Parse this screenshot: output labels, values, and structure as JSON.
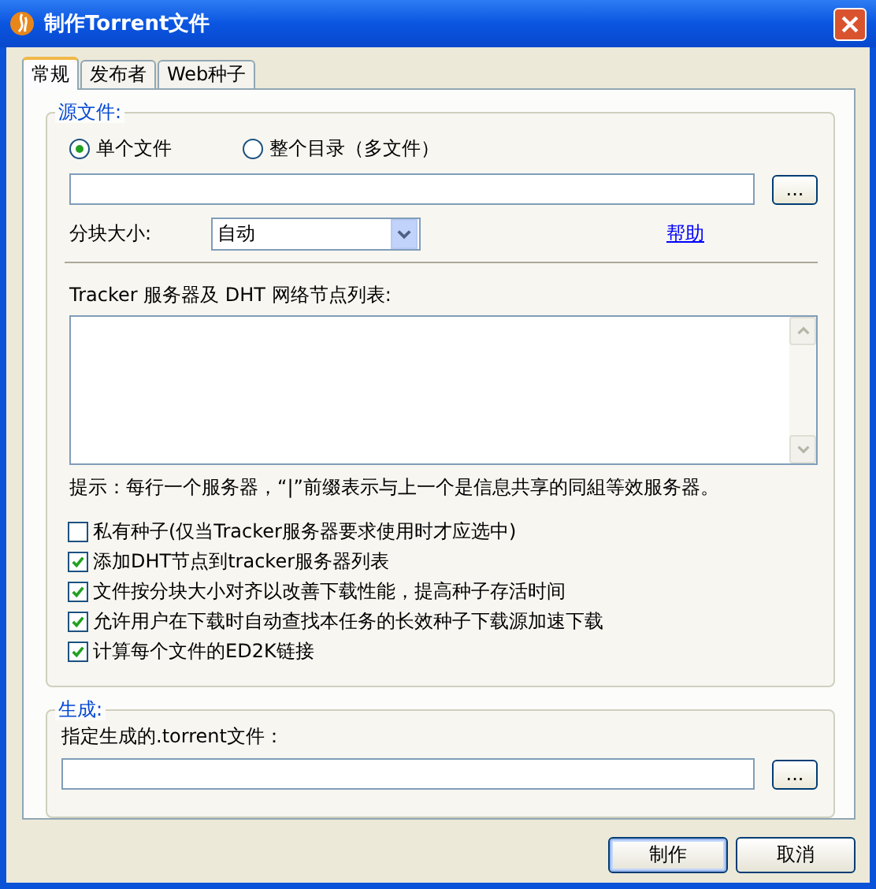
{
  "window": {
    "title": "制作Torrent文件"
  },
  "tabs": [
    {
      "label": "常规",
      "selected": true
    },
    {
      "label": "发布者",
      "selected": false
    },
    {
      "label": "Web种子",
      "selected": false
    }
  ],
  "source": {
    "legend": "源文件:",
    "modes": [
      {
        "label": "单个文件",
        "selected": true
      },
      {
        "label": "整个目录（多文件）",
        "selected": false
      }
    ],
    "browse_button": "...",
    "block_size": {
      "label": "分块大小:",
      "value": "自动"
    },
    "help_link": "帮助",
    "tracker_label": "Tracker 服务器及 DHT 网络节点列表:",
    "hint": "提示：每行一个服务器，“|”前缀表示与上一个是信息共享的同組等效服务器。"
  },
  "options": [
    {
      "label": "私有种子(仅当Tracker服务器要求使用时才应选中)",
      "checked": false
    },
    {
      "label": "添加DHT节点到tracker服务器列表",
      "checked": true
    },
    {
      "label": "文件按分块大小对齐以改善下载性能，提高种子存活时间",
      "checked": true
    },
    {
      "label": "允许用户在下载时自动查找本任务的长效种子下载源加速下载",
      "checked": true
    },
    {
      "label": "计算每个文件的ED2K链接",
      "checked": true
    }
  ],
  "output": {
    "legend": "生成:",
    "label": "指定生成的.torrent文件：",
    "browse_button": "..."
  },
  "buttons": [
    {
      "label": "制作",
      "default": true
    },
    {
      "label": "取消",
      "default": false
    }
  ]
}
